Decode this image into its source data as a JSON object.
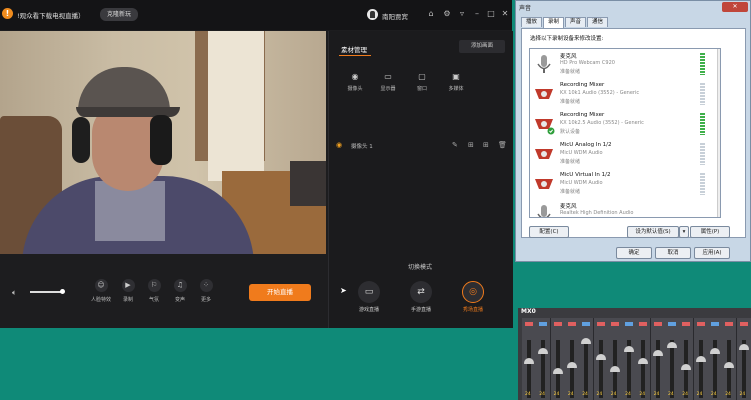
{
  "titlebar": {
    "warning_symbol": "!",
    "notice": "!观众看下载电视直播）",
    "help_button": "克隆新玩",
    "username": "南阳贾宾",
    "icons": [
      "home-icon",
      "settings-icon",
      "dropdown-icon",
      "minimize-icon",
      "maximize-icon",
      "close-icon"
    ]
  },
  "controls": {
    "tools": [
      {
        "label": "人脸特效",
        "icon": "face-effect-icon",
        "glyph": "☺"
      },
      {
        "label": "录制",
        "icon": "record-icon",
        "glyph": "▶"
      },
      {
        "label": "气氛",
        "icon": "atmosphere-icon",
        "glyph": "⚐"
      },
      {
        "label": "变声",
        "icon": "voice-change-icon",
        "glyph": "♫"
      },
      {
        "label": "更多",
        "icon": "more-icon",
        "glyph": "⁘"
      }
    ],
    "start_button": "开始直播"
  },
  "panel": {
    "title": "素材管理",
    "add_source_button": "添加画面",
    "source_types": [
      {
        "label": "摄像头",
        "icon": "camera-icon",
        "glyph": "◉"
      },
      {
        "label": "显示器",
        "icon": "monitor-icon",
        "glyph": "▭"
      },
      {
        "label": "窗口",
        "icon": "window-icon",
        "glyph": "▢"
      },
      {
        "label": "多媒体",
        "icon": "media-icon",
        "glyph": "▣"
      }
    ],
    "source_item": "摄像头 1",
    "mode_title": "切换模式",
    "modes": [
      {
        "label": "游戏直播",
        "icon": "game-live-icon",
        "glyph": "▭",
        "active": false
      },
      {
        "label": "手游直播",
        "icon": "mobile-live-icon",
        "glyph": "⇄",
        "active": false
      },
      {
        "label": "秀场直播",
        "icon": "show-live-icon",
        "glyph": "◎",
        "active": true
      }
    ]
  },
  "dialog": {
    "title": "声音",
    "tabs": [
      "播放",
      "录制",
      "声音",
      "通信"
    ],
    "selected_tab": 1,
    "instruction": "选择以下录制设备来修改设置:",
    "devices": [
      {
        "name": "麦克风",
        "driver": "HD Pro Webcam C920",
        "status": "准备就绪",
        "icon": "microphone-icon",
        "meter": "idle"
      },
      {
        "name": "Recording Mixer",
        "driver": "KX 10k1 Audio (3552) - Generic",
        "status": "准备就绪",
        "icon": "recording-mixer-icon",
        "meter": "idle"
      },
      {
        "name": "Recording Mixer",
        "driver": "KX 10k2.5 Audio (3552) - Generic",
        "status": "默认设备",
        "icon": "recording-mixer-icon",
        "meter": "active"
      },
      {
        "name": "MicU Analog In 1/2",
        "driver": "MicU WDM Audio",
        "status": "准备就绪",
        "icon": "analog-in-icon",
        "meter": "idle"
      },
      {
        "name": "MicU Virtual In 1/2",
        "driver": "MicU WDM Audio",
        "status": "准备就绪",
        "icon": "virtual-in-icon",
        "meter": "idle"
      },
      {
        "name": "麦克风",
        "driver": "Realtek High Definition Audio",
        "status": "",
        "icon": "microphone-icon",
        "meter": "idle"
      }
    ],
    "configure_button": "配置(C)",
    "set_default_button": "设为默认值(S)",
    "properties_button": "属性(P)",
    "ok_button": "确定",
    "cancel_button": "取消",
    "apply_button": "应用(A)"
  },
  "mixer": {
    "label": "MX0",
    "channel_values": [
      "24",
      "24",
      "24",
      "24",
      "24",
      "24",
      "24",
      "24",
      "24",
      "24",
      "24",
      "24",
      "24",
      "24",
      "24",
      "24"
    ]
  },
  "colors": {
    "accent": "#f07b1c",
    "desktop": "#0f8a78"
  }
}
